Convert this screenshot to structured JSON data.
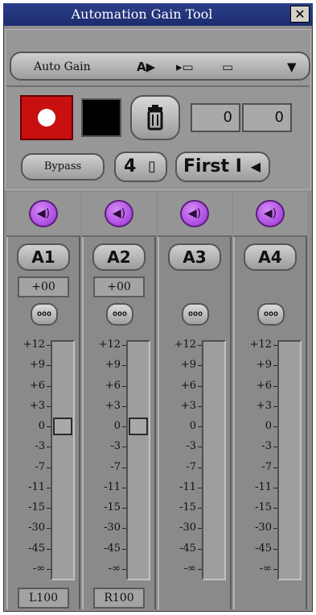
{
  "window": {
    "title": "Automation Gain Tool",
    "close_label": "✕"
  },
  "toolbar": {
    "mode_label": "Auto Gain",
    "icons": [
      "record-automation-icon",
      "play-clip-icon",
      "filmstrip-icon",
      "dropdown-arrow-icon"
    ]
  },
  "controls": {
    "record_label": "●",
    "trash_label": "🗑",
    "counter_left": "0",
    "counter_right": "0",
    "bypass_label": "Bypass",
    "track_count": "4",
    "mode_first": "First I"
  },
  "channels": [
    {
      "name": "A1",
      "gain": "+00",
      "pan": "L100",
      "speaker": "◀)",
      "link": "ooo",
      "fader_db": 0
    },
    {
      "name": "A2",
      "gain": "+00",
      "pan": "R100",
      "speaker": "◀)",
      "link": "ooo",
      "fader_db": 0
    },
    {
      "name": "A3",
      "gain": "",
      "pan": "",
      "speaker": "◀)",
      "link": "ooo",
      "fader_db": null
    },
    {
      "name": "A4",
      "gain": "",
      "pan": "",
      "speaker": "◀)",
      "link": "ooo",
      "fader_db": null
    }
  ],
  "scale": [
    "+12",
    "+9",
    "+6",
    "+3",
    "0",
    "-3",
    "-7",
    "-11",
    "-15",
    "-30",
    "-45",
    "-∞"
  ],
  "colors": {
    "titlebar": "#1c2b6e",
    "record": "#c81010",
    "speaker": "#b25be6",
    "panel": "#8d8d8d"
  }
}
